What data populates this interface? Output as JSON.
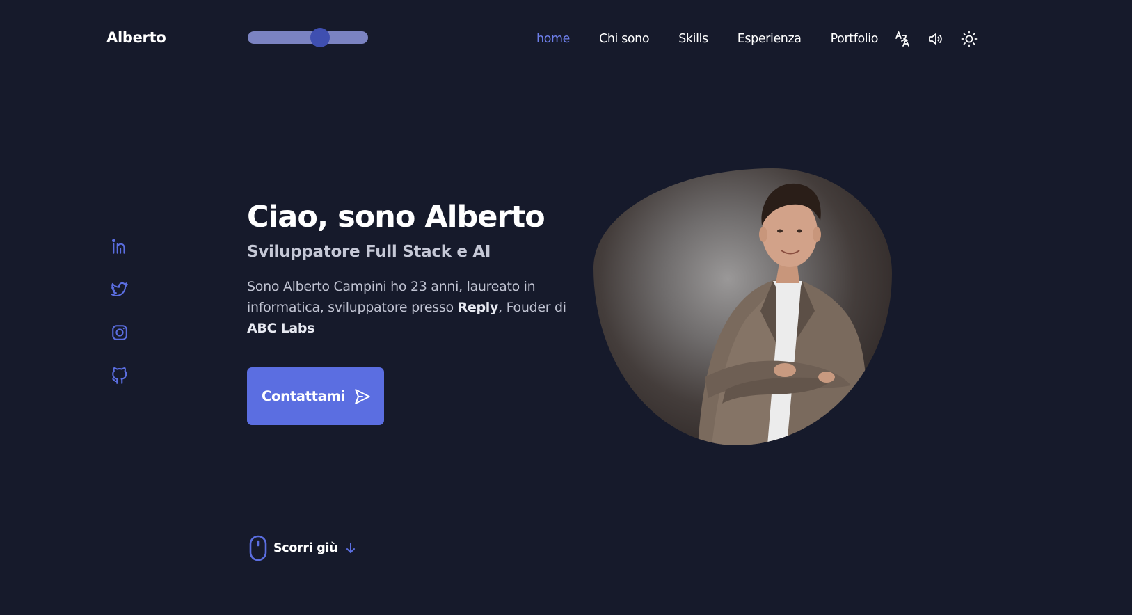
{
  "header": {
    "logo": "Alberto",
    "theme_slider_value": 0.62,
    "nav": [
      {
        "label": "home",
        "active": true
      },
      {
        "label": "Chi sono",
        "active": false
      },
      {
        "label": "Skills",
        "active": false
      },
      {
        "label": "Esperienza",
        "active": false
      },
      {
        "label": "Portfolio",
        "active": false
      }
    ],
    "icons": [
      "translate-icon",
      "volume-icon",
      "sun-icon"
    ]
  },
  "social": [
    "linkedin-icon",
    "twitter-icon",
    "instagram-icon",
    "github-icon"
  ],
  "hero": {
    "title": "Ciao, sono Alberto",
    "subtitle": "Sviluppatore Full Stack e AI",
    "desc_1": "Sono Alberto Campini ho 23 anni, laureato in informatica, sviluppatore presso ",
    "desc_bold_1": "Reply",
    "desc_2": ", Fouder di ",
    "desc_bold_2": "ABC Labs",
    "button_label": "Contattami"
  },
  "scroll": {
    "label": "Scorri giù"
  },
  "colors": {
    "background": "#161a2b",
    "accent": "#5b6ee1",
    "active_link": "#6d7ee8"
  }
}
